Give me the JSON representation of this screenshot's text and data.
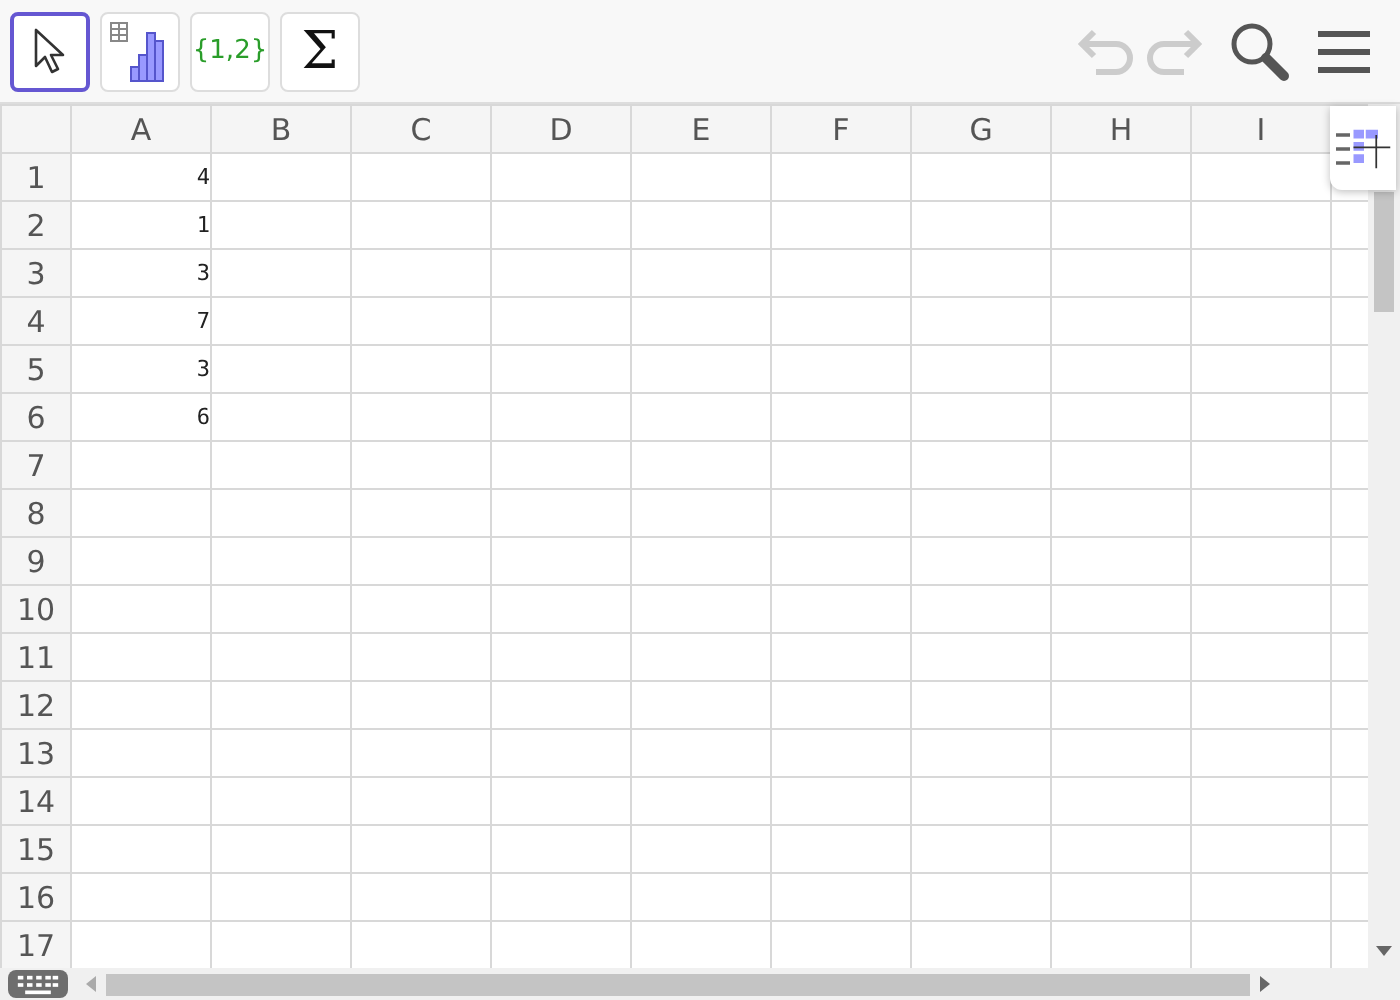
{
  "toolbar": {
    "tools": [
      {
        "kind": "pointer",
        "selected": true
      },
      {
        "kind": "chart",
        "selected": false
      },
      {
        "kind": "list",
        "label": "{1,2}",
        "selected": false
      },
      {
        "kind": "sum",
        "label": "Σ",
        "selected": false
      }
    ],
    "actions": [
      {
        "kind": "undo",
        "disabled": true
      },
      {
        "kind": "redo",
        "disabled": true
      },
      {
        "kind": "search",
        "disabled": false
      },
      {
        "kind": "menu",
        "disabled": false
      }
    ]
  },
  "spreadsheet": {
    "columns": [
      "A",
      "B",
      "C",
      "D",
      "E",
      "F",
      "G",
      "H",
      "I"
    ],
    "rows": [
      {
        "label": "1",
        "cells": [
          "4"
        ]
      },
      {
        "label": "2",
        "cells": [
          "1"
        ]
      },
      {
        "label": "3",
        "cells": [
          "3"
        ]
      },
      {
        "label": "4",
        "cells": [
          "7"
        ]
      },
      {
        "label": "5",
        "cells": [
          "3"
        ]
      },
      {
        "label": "6",
        "cells": [
          "6"
        ]
      },
      {
        "label": "7",
        "cells": []
      },
      {
        "label": "8",
        "cells": []
      },
      {
        "label": "9",
        "cells": []
      },
      {
        "label": "10",
        "cells": []
      },
      {
        "label": "11",
        "cells": []
      },
      {
        "label": "12",
        "cells": []
      },
      {
        "label": "13",
        "cells": []
      },
      {
        "label": "14",
        "cells": []
      },
      {
        "label": "15",
        "cells": []
      },
      {
        "label": "16",
        "cells": []
      },
      {
        "label": "17",
        "cells": []
      }
    ]
  }
}
